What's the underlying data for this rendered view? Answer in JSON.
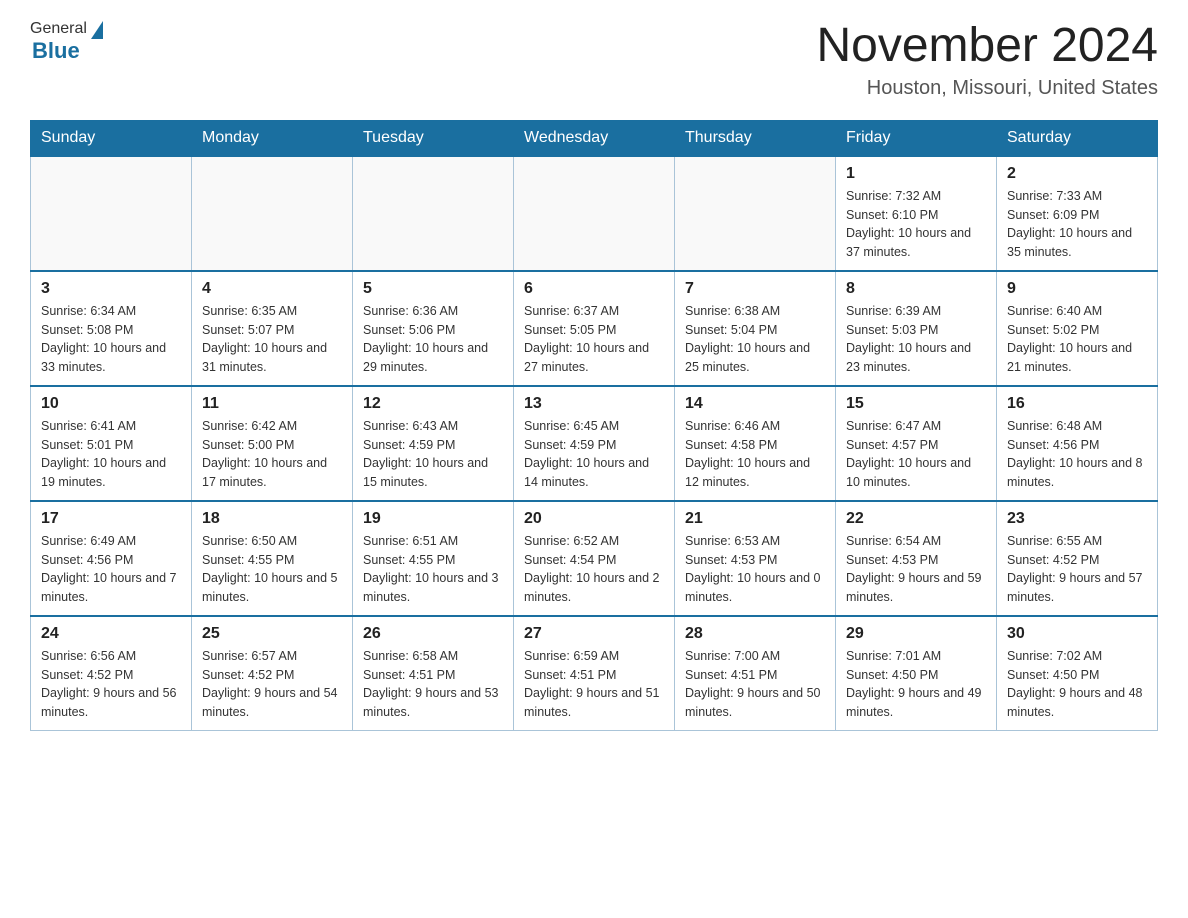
{
  "header": {
    "logo_general": "General",
    "logo_blue": "Blue",
    "month_title": "November 2024",
    "location": "Houston, Missouri, United States"
  },
  "weekdays": [
    "Sunday",
    "Monday",
    "Tuesday",
    "Wednesday",
    "Thursday",
    "Friday",
    "Saturday"
  ],
  "weeks": [
    [
      {
        "day": "",
        "sunrise": "",
        "sunset": "",
        "daylight": ""
      },
      {
        "day": "",
        "sunrise": "",
        "sunset": "",
        "daylight": ""
      },
      {
        "day": "",
        "sunrise": "",
        "sunset": "",
        "daylight": ""
      },
      {
        "day": "",
        "sunrise": "",
        "sunset": "",
        "daylight": ""
      },
      {
        "day": "",
        "sunrise": "",
        "sunset": "",
        "daylight": ""
      },
      {
        "day": "1",
        "sunrise": "Sunrise: 7:32 AM",
        "sunset": "Sunset: 6:10 PM",
        "daylight": "Daylight: 10 hours and 37 minutes."
      },
      {
        "day": "2",
        "sunrise": "Sunrise: 7:33 AM",
        "sunset": "Sunset: 6:09 PM",
        "daylight": "Daylight: 10 hours and 35 minutes."
      }
    ],
    [
      {
        "day": "3",
        "sunrise": "Sunrise: 6:34 AM",
        "sunset": "Sunset: 5:08 PM",
        "daylight": "Daylight: 10 hours and 33 minutes."
      },
      {
        "day": "4",
        "sunrise": "Sunrise: 6:35 AM",
        "sunset": "Sunset: 5:07 PM",
        "daylight": "Daylight: 10 hours and 31 minutes."
      },
      {
        "day": "5",
        "sunrise": "Sunrise: 6:36 AM",
        "sunset": "Sunset: 5:06 PM",
        "daylight": "Daylight: 10 hours and 29 minutes."
      },
      {
        "day": "6",
        "sunrise": "Sunrise: 6:37 AM",
        "sunset": "Sunset: 5:05 PM",
        "daylight": "Daylight: 10 hours and 27 minutes."
      },
      {
        "day": "7",
        "sunrise": "Sunrise: 6:38 AM",
        "sunset": "Sunset: 5:04 PM",
        "daylight": "Daylight: 10 hours and 25 minutes."
      },
      {
        "day": "8",
        "sunrise": "Sunrise: 6:39 AM",
        "sunset": "Sunset: 5:03 PM",
        "daylight": "Daylight: 10 hours and 23 minutes."
      },
      {
        "day": "9",
        "sunrise": "Sunrise: 6:40 AM",
        "sunset": "Sunset: 5:02 PM",
        "daylight": "Daylight: 10 hours and 21 minutes."
      }
    ],
    [
      {
        "day": "10",
        "sunrise": "Sunrise: 6:41 AM",
        "sunset": "Sunset: 5:01 PM",
        "daylight": "Daylight: 10 hours and 19 minutes."
      },
      {
        "day": "11",
        "sunrise": "Sunrise: 6:42 AM",
        "sunset": "Sunset: 5:00 PM",
        "daylight": "Daylight: 10 hours and 17 minutes."
      },
      {
        "day": "12",
        "sunrise": "Sunrise: 6:43 AM",
        "sunset": "Sunset: 4:59 PM",
        "daylight": "Daylight: 10 hours and 15 minutes."
      },
      {
        "day": "13",
        "sunrise": "Sunrise: 6:45 AM",
        "sunset": "Sunset: 4:59 PM",
        "daylight": "Daylight: 10 hours and 14 minutes."
      },
      {
        "day": "14",
        "sunrise": "Sunrise: 6:46 AM",
        "sunset": "Sunset: 4:58 PM",
        "daylight": "Daylight: 10 hours and 12 minutes."
      },
      {
        "day": "15",
        "sunrise": "Sunrise: 6:47 AM",
        "sunset": "Sunset: 4:57 PM",
        "daylight": "Daylight: 10 hours and 10 minutes."
      },
      {
        "day": "16",
        "sunrise": "Sunrise: 6:48 AM",
        "sunset": "Sunset: 4:56 PM",
        "daylight": "Daylight: 10 hours and 8 minutes."
      }
    ],
    [
      {
        "day": "17",
        "sunrise": "Sunrise: 6:49 AM",
        "sunset": "Sunset: 4:56 PM",
        "daylight": "Daylight: 10 hours and 7 minutes."
      },
      {
        "day": "18",
        "sunrise": "Sunrise: 6:50 AM",
        "sunset": "Sunset: 4:55 PM",
        "daylight": "Daylight: 10 hours and 5 minutes."
      },
      {
        "day": "19",
        "sunrise": "Sunrise: 6:51 AM",
        "sunset": "Sunset: 4:55 PM",
        "daylight": "Daylight: 10 hours and 3 minutes."
      },
      {
        "day": "20",
        "sunrise": "Sunrise: 6:52 AM",
        "sunset": "Sunset: 4:54 PM",
        "daylight": "Daylight: 10 hours and 2 minutes."
      },
      {
        "day": "21",
        "sunrise": "Sunrise: 6:53 AM",
        "sunset": "Sunset: 4:53 PM",
        "daylight": "Daylight: 10 hours and 0 minutes."
      },
      {
        "day": "22",
        "sunrise": "Sunrise: 6:54 AM",
        "sunset": "Sunset: 4:53 PM",
        "daylight": "Daylight: 9 hours and 59 minutes."
      },
      {
        "day": "23",
        "sunrise": "Sunrise: 6:55 AM",
        "sunset": "Sunset: 4:52 PM",
        "daylight": "Daylight: 9 hours and 57 minutes."
      }
    ],
    [
      {
        "day": "24",
        "sunrise": "Sunrise: 6:56 AM",
        "sunset": "Sunset: 4:52 PM",
        "daylight": "Daylight: 9 hours and 56 minutes."
      },
      {
        "day": "25",
        "sunrise": "Sunrise: 6:57 AM",
        "sunset": "Sunset: 4:52 PM",
        "daylight": "Daylight: 9 hours and 54 minutes."
      },
      {
        "day": "26",
        "sunrise": "Sunrise: 6:58 AM",
        "sunset": "Sunset: 4:51 PM",
        "daylight": "Daylight: 9 hours and 53 minutes."
      },
      {
        "day": "27",
        "sunrise": "Sunrise: 6:59 AM",
        "sunset": "Sunset: 4:51 PM",
        "daylight": "Daylight: 9 hours and 51 minutes."
      },
      {
        "day": "28",
        "sunrise": "Sunrise: 7:00 AM",
        "sunset": "Sunset: 4:51 PM",
        "daylight": "Daylight: 9 hours and 50 minutes."
      },
      {
        "day": "29",
        "sunrise": "Sunrise: 7:01 AM",
        "sunset": "Sunset: 4:50 PM",
        "daylight": "Daylight: 9 hours and 49 minutes."
      },
      {
        "day": "30",
        "sunrise": "Sunrise: 7:02 AM",
        "sunset": "Sunset: 4:50 PM",
        "daylight": "Daylight: 9 hours and 48 minutes."
      }
    ]
  ]
}
